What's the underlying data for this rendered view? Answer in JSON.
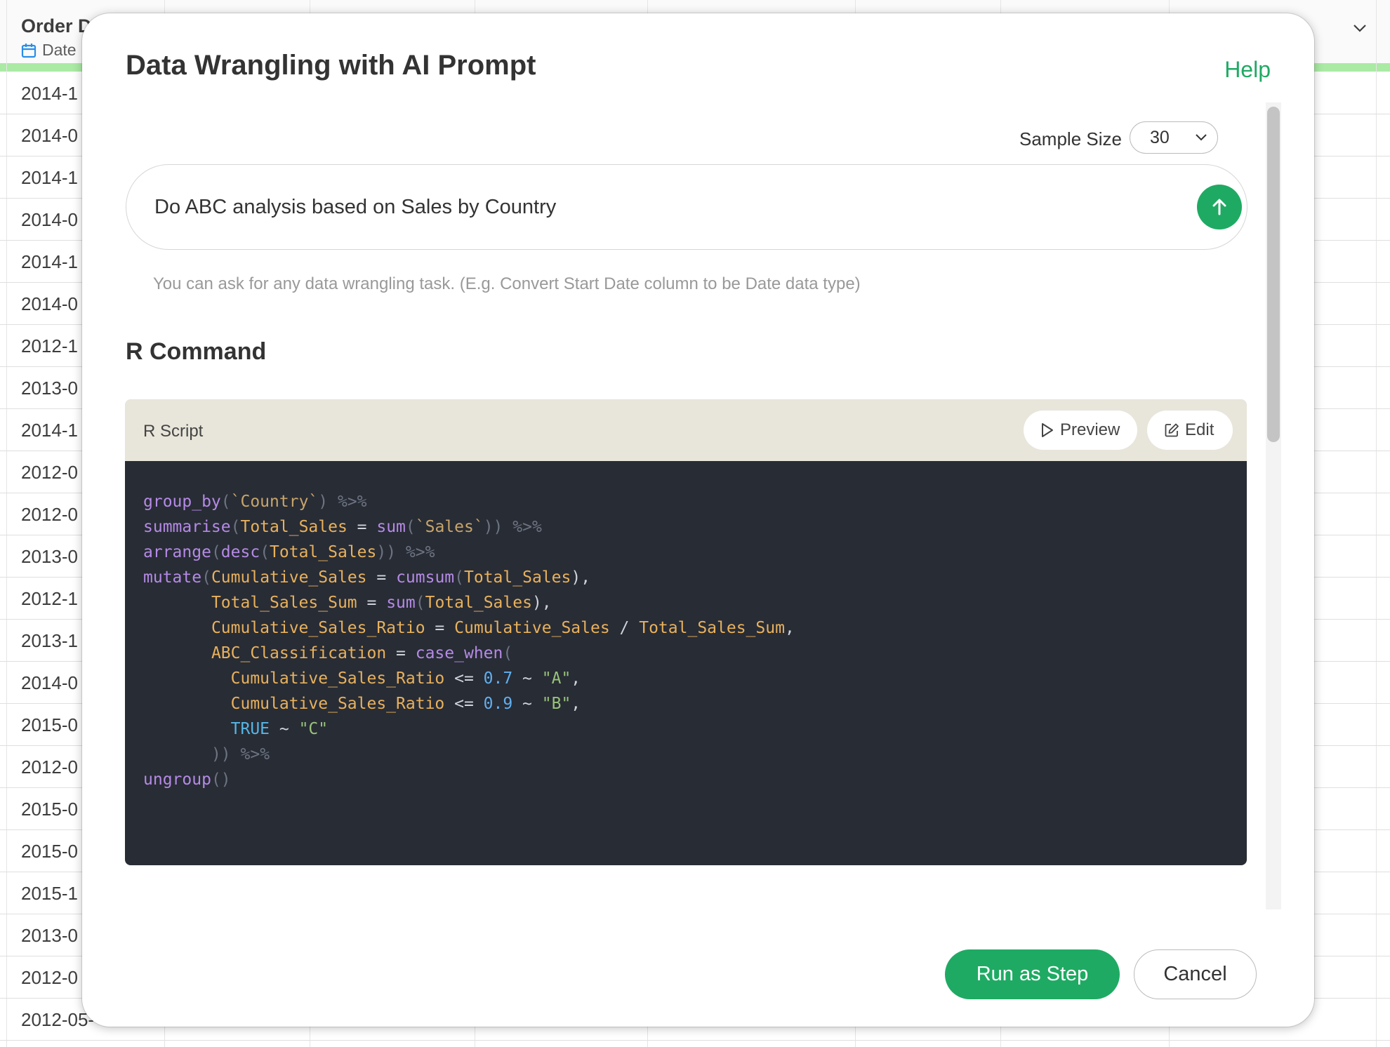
{
  "sheet": {
    "column_title": "Order D",
    "column_type": "Date",
    "rows": [
      "2014-1",
      "2014-0",
      "2014-1",
      "2014-0",
      "2014-1",
      "2014-0",
      "2012-1",
      "2013-0",
      "2014-1",
      "2012-0",
      "2012-0",
      "2013-0",
      "2012-1",
      "2013-1",
      "2014-0",
      "2015-0",
      "2012-0",
      "2015-0",
      "2015-0",
      "2015-1",
      "2013-0",
      "2012-0",
      "2012-05-"
    ]
  },
  "modal": {
    "title": "Data Wrangling with AI Prompt",
    "help": "Help",
    "sample_size_label": "Sample Size",
    "sample_size_value": "30",
    "prompt_text": "Do ABC analysis based on Sales by Country",
    "hint": "You can ask for any data wrangling task. (E.g. Convert Start Date column to be Date data type)",
    "section_title": "R Command",
    "script_label": "R Script",
    "preview_label": "Preview",
    "edit_label": "Edit",
    "run_label": "Run as Step",
    "cancel_label": "Cancel"
  },
  "code": {
    "l1": [
      "group_by",
      "(",
      "`Country`",
      ") ",
      "%>%"
    ],
    "l2": [
      "summarise",
      "(",
      "Total_Sales",
      " = ",
      "sum",
      "(",
      "`Sales`",
      ")) ",
      "%>%"
    ],
    "l3": [
      "arrange",
      "(",
      "desc",
      "(",
      "Total_Sales",
      ")) ",
      "%>%"
    ],
    "l4": [
      "mutate",
      "(",
      "Cumulative_Sales",
      " = ",
      "cumsum",
      "(",
      "Total_Sales",
      "),"
    ],
    "l5": [
      "       ",
      "Total_Sales_Sum",
      " = ",
      "sum",
      "(",
      "Total_Sales",
      "),"
    ],
    "l6": [
      "       ",
      "Cumulative_Sales_Ratio",
      " = ",
      "Cumulative_Sales",
      " / ",
      "Total_Sales_Sum",
      ","
    ],
    "l7": [
      "       ",
      "ABC_Classification",
      " = ",
      "case_when",
      "("
    ],
    "l8": [
      "         ",
      "Cumulative_Sales_Ratio",
      " <= ",
      "0.7",
      " ~ ",
      "\"A\"",
      ","
    ],
    "l9": [
      "         ",
      "Cumulative_Sales_Ratio",
      " <= ",
      "0.9",
      " ~ ",
      "\"B\"",
      ","
    ],
    "l10": [
      "         ",
      "TRUE",
      " ~ ",
      "\"C\""
    ],
    "l11": [
      "       ",
      "))",
      " ",
      "%>%"
    ],
    "l12": [
      "ungroup",
      "()"
    ]
  },
  "colors": {
    "accent": "#1faa63",
    "code_bg": "#282c35",
    "script_header_bg": "#e8e5da"
  }
}
